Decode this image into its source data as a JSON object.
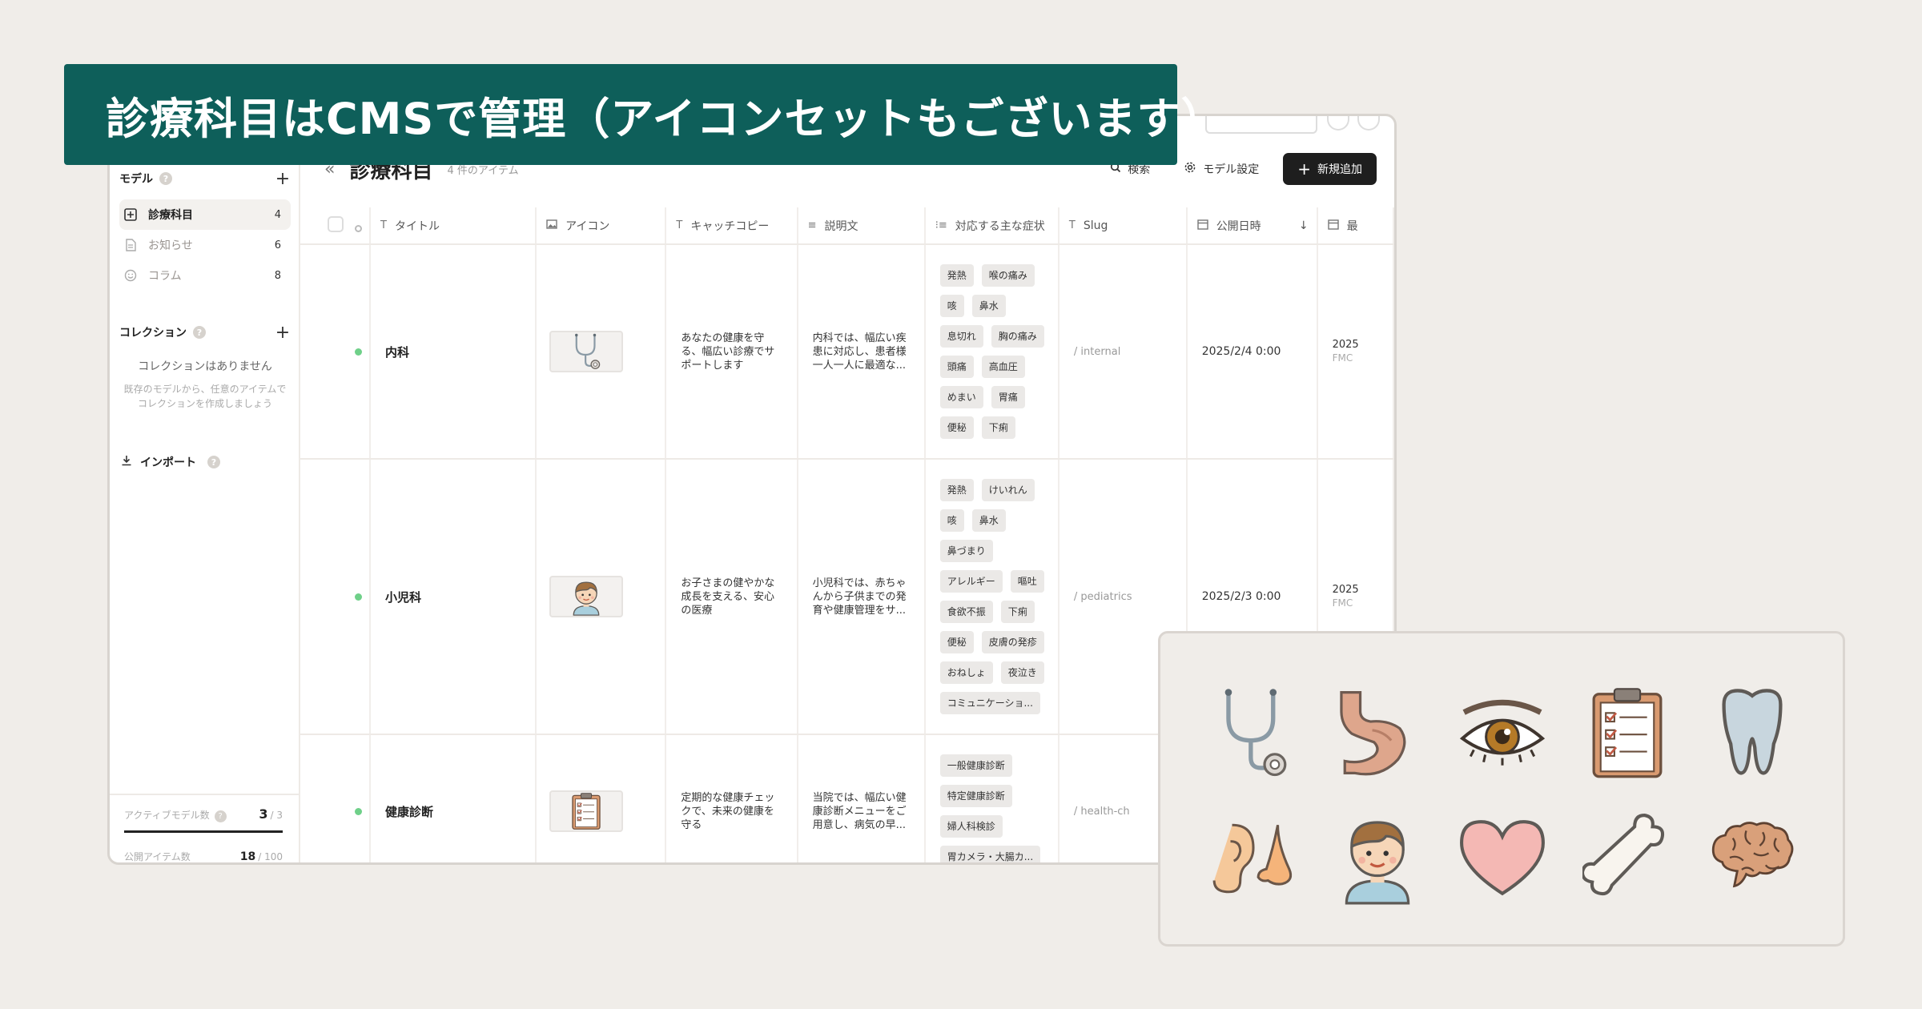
{
  "banner": {
    "title": "診療科目はCMSで管理（アイコンセットもございます）"
  },
  "sidebar": {
    "models_label": "モデル",
    "models": [
      {
        "label": "診療科目",
        "count": "4",
        "icon": "plus-box-icon",
        "active": true
      },
      {
        "label": "お知らせ",
        "count": "6",
        "icon": "document-icon",
        "active": false
      },
      {
        "label": "コラム",
        "count": "8",
        "icon": "smile-icon",
        "active": false
      }
    ],
    "collections_label": "コレクション",
    "collections_empty_title": "コレクションはありません",
    "collections_empty_desc_1": "既存のモデルから、任意のアイテムで",
    "collections_empty_desc_2": "コレクションを作成しましょう",
    "import_label": "インポート",
    "stats": {
      "active_models_label": "アクティブモデル数",
      "active_models_value": "3",
      "active_models_total": "/ 3",
      "active_models_fraction": 1.0,
      "public_items_label": "公開アイテム数",
      "public_items_value": "18",
      "public_items_total": "/ 100"
    }
  },
  "main": {
    "title": "診療科目",
    "item_count": "4 件のアイテム",
    "search_label": "検索",
    "model_settings_label": "モデル設定",
    "add_new_label": "新規追加",
    "columns": [
      "タイトル",
      "アイコン",
      "キャッチコピー",
      "説明文",
      "対応する主な症状",
      "Slug",
      "公開日時"
    ],
    "rows": [
      {
        "title": "内科",
        "icon": "stethoscope-icon",
        "catch_1": "あなたの健康を守",
        "catch_2": "る、幅広い診療でサ",
        "catch_3": "ポートします",
        "desc_1": "内科では、幅広い疾",
        "desc_2": "患に対応し、患者様",
        "desc_3": "一人一人に最適な...",
        "tags": [
          [
            "発熱",
            "喉の痛み"
          ],
          [
            "咳",
            "鼻水"
          ],
          [
            "息切れ",
            "胸の痛み"
          ],
          [
            "頭痛",
            "高血圧"
          ],
          [
            "めまい",
            "胃痛"
          ],
          [
            "便秘",
            "下痢"
          ]
        ],
        "slug": "/ internal",
        "date": "2025/2/4 0:00",
        "last_1": "2025",
        "last_2": "FMC"
      },
      {
        "title": "小児科",
        "icon": "child-icon",
        "catch_1": "お子さまの健やかな",
        "catch_2": "成長を支える、安心",
        "catch_3": "の医療",
        "desc_1": "小児科では、赤ちゃ",
        "desc_2": "んから子供までの発",
        "desc_3": "育や健康管理をサ...",
        "tags": [
          [
            "発熱",
            "けいれん"
          ],
          [
            "咳",
            "鼻水"
          ],
          [
            "鼻づまり"
          ],
          [
            "アレルギー",
            "嘔吐"
          ],
          [
            "食欲不振",
            "下痢"
          ],
          [
            "便秘",
            "皮膚の発疹"
          ],
          [
            "おねしょ",
            "夜泣き"
          ],
          [
            "コミュニケーショ..."
          ]
        ],
        "slug": "/ pediatrics",
        "date": "2025/2/3 0:00",
        "last_1": "2025",
        "last_2": "FMC"
      },
      {
        "title": "健康診断",
        "icon": "clipboard-icon",
        "catch_1": "定期的な健康チェッ",
        "catch_2": "クで、未来の健康を",
        "catch_3": "守る",
        "desc_1": "当院では、幅広い健",
        "desc_2": "康診断メニューをご",
        "desc_3": "用意し、病気の早...",
        "tags": [
          [
            "一般健康診断"
          ],
          [
            "特定健康診断"
          ],
          [
            "婦人科検診"
          ],
          [
            "胃カメラ・大腸カ..."
          ]
        ],
        "slug": "/ health-ch",
        "date": "",
        "last_1": "",
        "last_2": ""
      }
    ]
  },
  "icon_set": [
    "stethoscope-icon",
    "stomach-icon",
    "eye-icon",
    "clipboard-icon",
    "tooth-icon",
    "ear-nose-icon",
    "child-icon",
    "heart-icon",
    "bone-icon",
    "brain-icon"
  ],
  "colors": {
    "banner_bg": "#0e5f5a",
    "status_green": "#6fd089",
    "primary_button": "#1e1e1e",
    "page_bg": "#f0ede9"
  }
}
